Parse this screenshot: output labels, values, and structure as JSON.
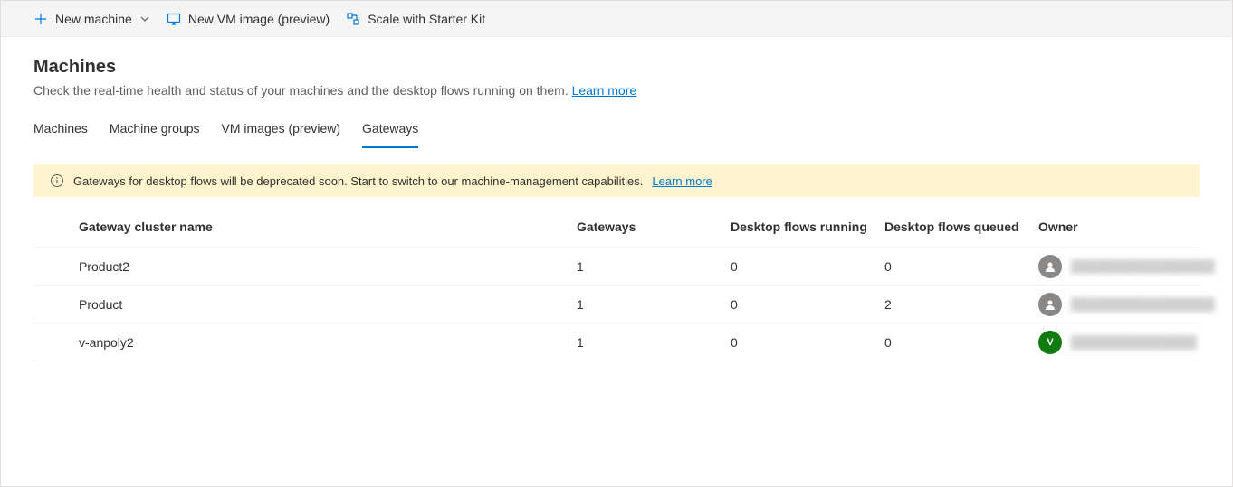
{
  "toolbar": {
    "new_machine": "New machine",
    "new_vm_image": "New VM image (preview)",
    "scale_starter_kit": "Scale with Starter Kit"
  },
  "header": {
    "title": "Machines",
    "description": "Check the real-time health and status of your machines and the desktop flows running on them. ",
    "learn_more": "Learn more"
  },
  "tabs": [
    {
      "label": "Machines"
    },
    {
      "label": "Machine groups"
    },
    {
      "label": "VM images (preview)"
    },
    {
      "label": "Gateways"
    }
  ],
  "active_tab": 3,
  "banner": {
    "text": "Gateways for desktop flows will be deprecated soon. Start to switch to our machine-management capabilities.",
    "link": "Learn more"
  },
  "table": {
    "columns": {
      "name": "Gateway cluster name",
      "gateways": "Gateways",
      "running": "Desktop flows running",
      "queued": "Desktop flows queued",
      "owner": "Owner"
    },
    "rows": [
      {
        "name": "Product2",
        "gateways": "1",
        "running": "0",
        "queued": "0",
        "owner_label": "",
        "avatar_style": "grey",
        "avatar_initial": ""
      },
      {
        "name": "Product",
        "gateways": "1",
        "running": "0",
        "queued": "2",
        "owner_label": "",
        "avatar_style": "grey",
        "avatar_initial": ""
      },
      {
        "name": "v-anpoly2",
        "gateways": "1",
        "running": "0",
        "queued": "0",
        "owner_label": "",
        "avatar_style": "green",
        "avatar_initial": "V"
      }
    ]
  }
}
